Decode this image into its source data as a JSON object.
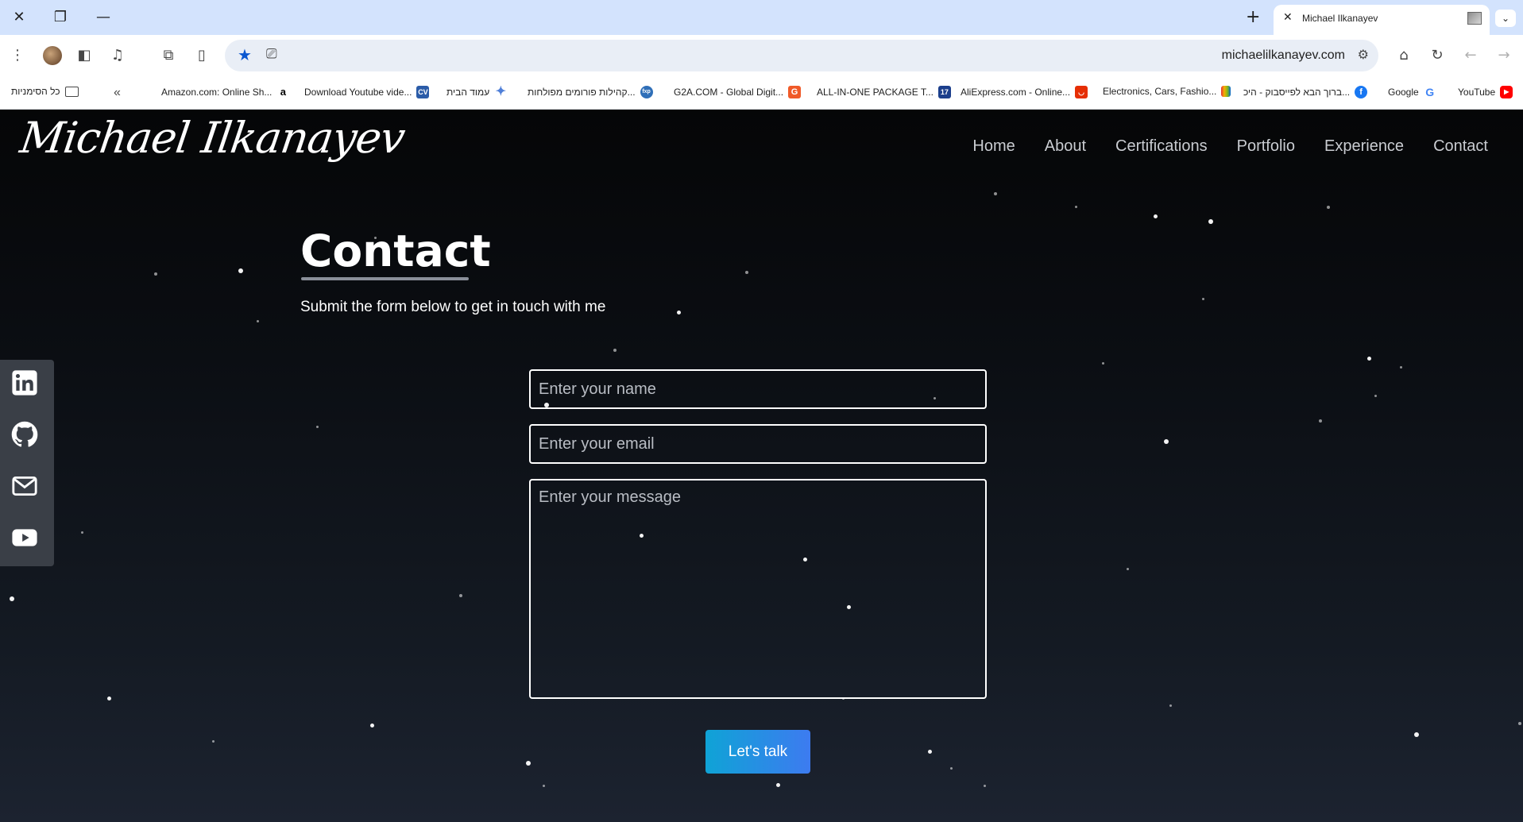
{
  "browser": {
    "tab_title": "Michael Ilkanayev",
    "url": "michaelilkanayev.com",
    "bookmarks": [
      {
        "label": "כל הסימניות",
        "icon": "folder-icon"
      },
      {
        "label": "Amazon.com: Online Sh...",
        "icon": "amazon-icon"
      },
      {
        "label": "Download Youtube vide...",
        "icon": "cv-icon"
      },
      {
        "label": "עמוד הבית",
        "icon": "gemini-icon"
      },
      {
        "label": "קהילות פורומים מפולחות...",
        "icon": "fxp-icon"
      },
      {
        "label": "G2A.COM - Global Digit...",
        "icon": "g2a-icon"
      },
      {
        "label": "ALL-IN-ONE PACKAGE T...",
        "icon": "17track-icon"
      },
      {
        "label": "AliExpress.com - Online...",
        "icon": "aliexpress-icon"
      },
      {
        "label": "Electronics, Cars, Fashio...",
        "icon": "ebay-icon"
      },
      {
        "label": "ברוך הבא לפייסבוק - היכ...",
        "icon": "facebook-icon"
      },
      {
        "label": "Google",
        "icon": "google-icon"
      },
      {
        "label": "YouTube",
        "icon": "youtube-icon"
      }
    ]
  },
  "site": {
    "logo": "Michael Ilkanayev",
    "nav": [
      "Home",
      "About",
      "Certifications",
      "Portfolio",
      "Experience",
      "Contact"
    ]
  },
  "contact": {
    "title": "Contact",
    "subtitle": "Submit the form below to get in touch with me",
    "name_placeholder": "Enter your name",
    "email_placeholder": "Enter your email",
    "message_placeholder": "Enter your message",
    "submit_label": "Let's talk"
  },
  "social": [
    "linkedin-icon",
    "github-icon",
    "mail-icon",
    "youtube-icon"
  ],
  "colors": {
    "accent_start": "#0fa3d6",
    "accent_end": "#3d7bf0",
    "background_top": "#050607",
    "background_bottom": "#1c2330"
  }
}
